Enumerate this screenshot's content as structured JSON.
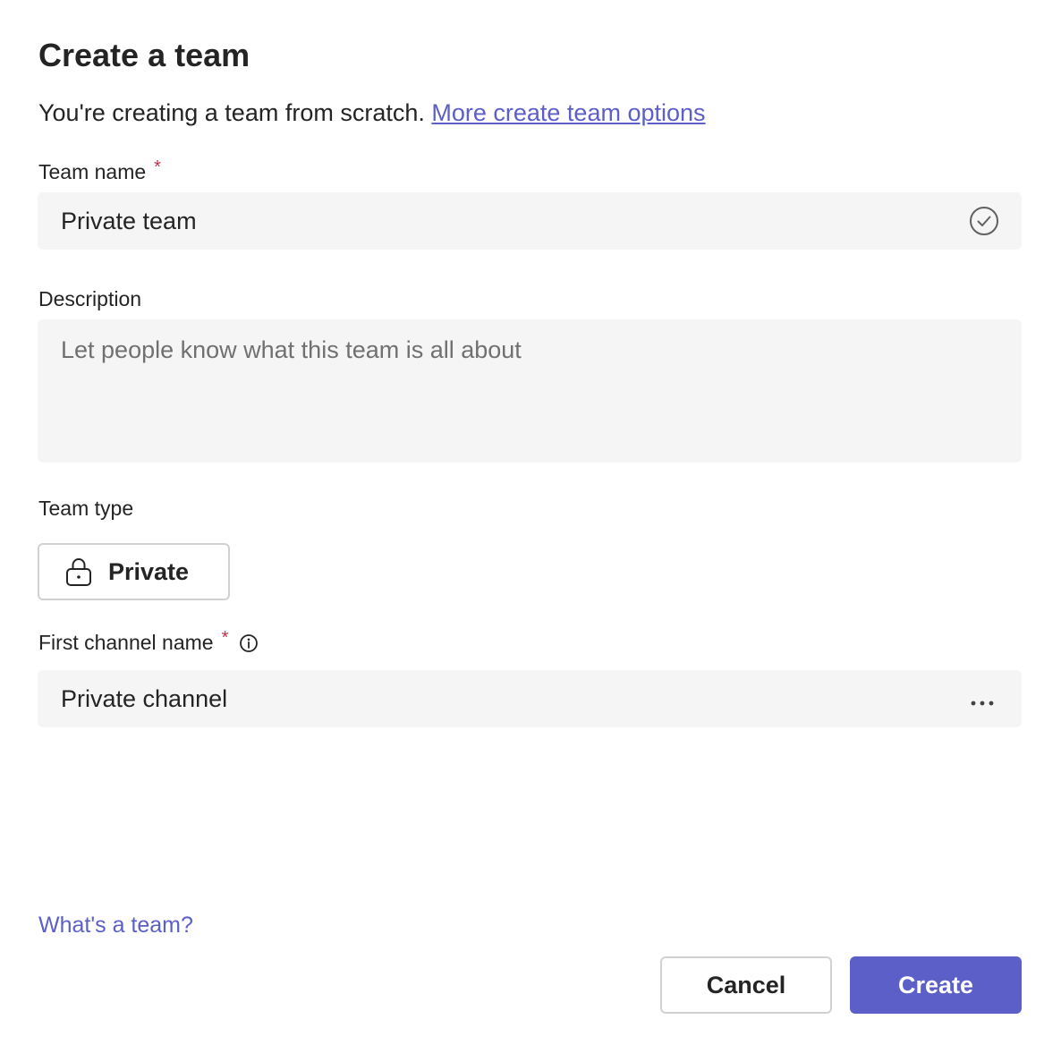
{
  "dialog": {
    "title": "Create a team",
    "subtitle_text": "You're creating a team from scratch.",
    "subtitle_link": "More create team options"
  },
  "team_name": {
    "label": "Team name",
    "required_mark": "*",
    "value": "Private team",
    "status_icon": "check-circle-icon"
  },
  "description": {
    "label": "Description",
    "placeholder": "Let people know what this team is all about"
  },
  "team_type": {
    "label": "Team type",
    "selected": "Private",
    "icon": "lock-icon"
  },
  "first_channel": {
    "label": "First channel name",
    "required_mark": "*",
    "info_icon": "info-icon",
    "value": "Private channel",
    "more_icon": "more-horizontal-icon"
  },
  "footer": {
    "help_link": "What's a team?",
    "cancel_label": "Cancel",
    "create_label": "Create"
  },
  "colors": {
    "accent": "#5b5fc7",
    "required": "#c4314b",
    "field_bg": "#f5f5f5"
  }
}
